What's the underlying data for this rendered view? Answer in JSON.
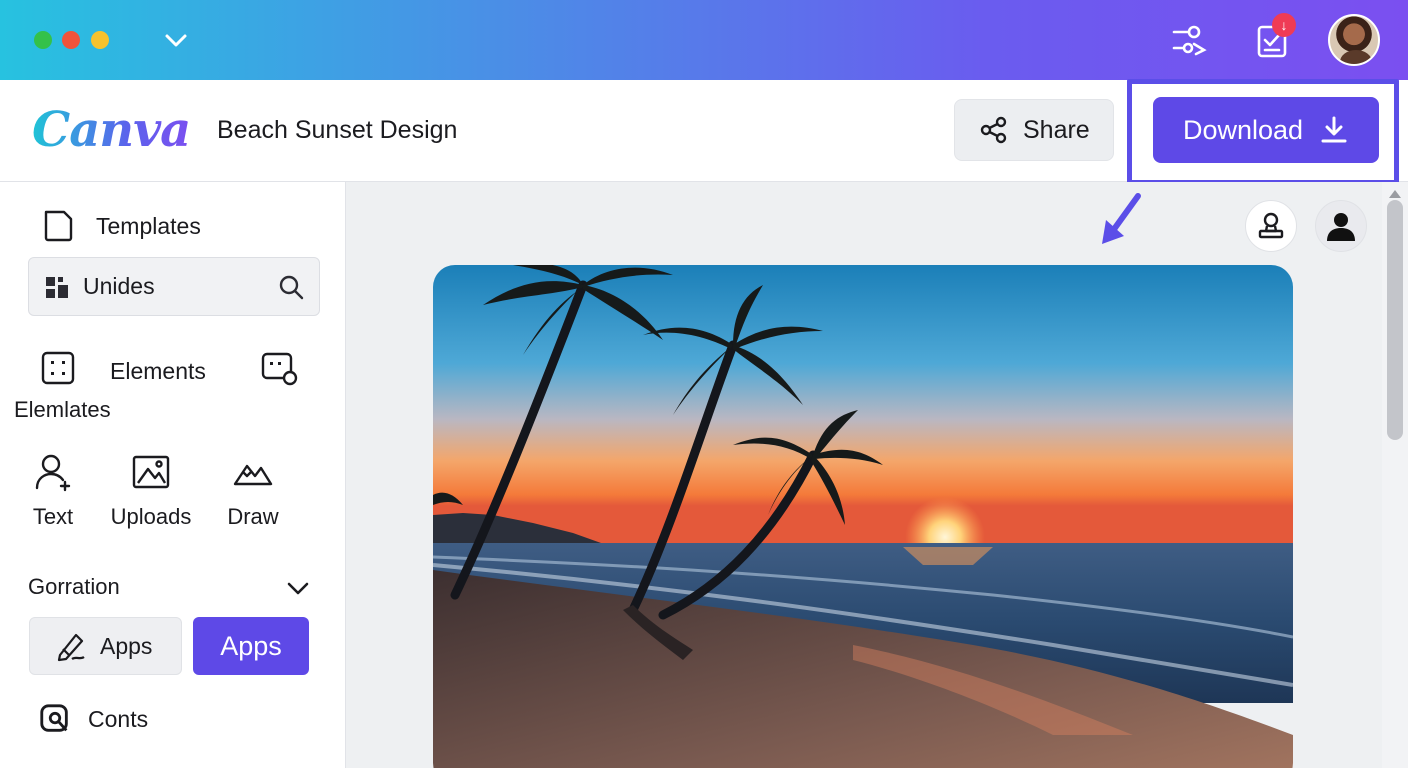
{
  "window": {
    "traffic_lights": [
      "close",
      "minimize",
      "maximize"
    ],
    "notification_count": "↓"
  },
  "header": {
    "logo_text": "Canva",
    "doc_title": "Beach Sunset Design",
    "share_label": "Share",
    "download_label": "Download"
  },
  "sidebar": {
    "templates_label": "Templates",
    "search_label": "Unides",
    "elements_label": "Elements",
    "elemlates_label": "Elemlates",
    "tools": [
      {
        "label": "Text"
      },
      {
        "label": "Uploads"
      },
      {
        "label": "Draw"
      }
    ],
    "section_label": "Gorration",
    "apps_secondary_label": "Apps",
    "apps_primary_label": "Apps",
    "conts_label": "Conts"
  },
  "colors": {
    "accent": "#5e49e7",
    "highlight_frame": "#5b4ee8",
    "badge": "#ef3b55"
  },
  "icons": [
    "chevron-down-icon",
    "filter-settings-icon",
    "clipboard-check-icon",
    "share-icon",
    "download-icon",
    "template-icon",
    "brand-icon",
    "search-icon",
    "elements-icon",
    "elements-alt-icon",
    "text-user-icon",
    "uploads-image-icon",
    "draw-mountain-icon",
    "chevron-down-icon",
    "apps-pencil-icon",
    "conts-icon",
    "arrow-pointer-icon",
    "stamp-icon",
    "user-icon"
  ]
}
